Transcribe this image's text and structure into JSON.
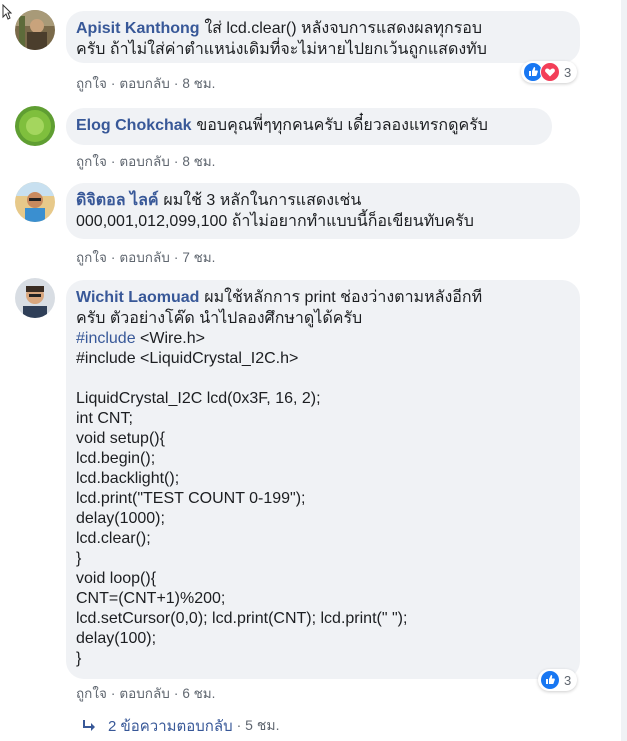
{
  "comments": [
    {
      "author": "Apisit Kanthong",
      "text_line1": "ใส่ lcd.clear() หลังจบการแสดงผลทุกรอบ",
      "text_line2": "ครับ ถ้าไม่ใส่ค่าตำแหน่งเดิมที่จะไม่หายไปยกเว้นถูกแสดงทับ",
      "like_label": "ถูกใจ",
      "reply_label": "ตอบกลับ",
      "time": "8 ชม.",
      "reaction_count": "3",
      "reaction_icons": [
        "like-icon",
        "love-icon"
      ]
    },
    {
      "author": "Elog Chokchak",
      "text_line1": "ขอบคุณพี่ๆทุกคนครับ เดี๋ยวลองแทรกดูครับ",
      "like_label": "ถูกใจ",
      "reply_label": "ตอบกลับ",
      "time": "8 ชม."
    },
    {
      "author": "ดิจิตอล ไลค์",
      "text_line1": "ผมใช้ 3 หลักในการแสดงเช่น",
      "text_line2": "000,001,012,099,100 ถ้าไม่อยากทำแบบนี้ก็อเขียนทับครับ",
      "like_label": "ถูกใจ",
      "reply_label": "ตอบกลับ",
      "time": "7 ชม."
    },
    {
      "author": "Wichit Laomuad",
      "text_line1": "ผมใช้หลักการ print ช่องว่างตามหลังอีกที",
      "text_line2": "ครับ ตัวอย่างโค๊ด นำไปลองศึกษาดูได้ครับ",
      "code_hash_1": "#include",
      "code_rest_1": " <Wire.h>",
      "code_lines": [
        "#include <LiquidCrystal_I2C.h>",
        "",
        "LiquidCrystal_I2C lcd(0x3F, 16, 2);",
        "int CNT;",
        "void setup(){",
        "lcd.begin();",
        "lcd.backlight();",
        "lcd.print(\"TEST COUNT 0-199\");",
        "delay(1000);",
        "lcd.clear();",
        "}",
        "void loop(){",
        "CNT=(CNT+1)%200;",
        "lcd.setCursor(0,0); lcd.print(CNT); lcd.print(\" \");",
        "delay(100);",
        "}"
      ],
      "like_label": "ถูกใจ",
      "reply_label": "ตอบกลับ",
      "time": "6 ชม.",
      "reaction_count": "3",
      "reaction_icons": [
        "like-icon"
      ]
    }
  ],
  "replies_link": {
    "label": "2 ข้อความตอบกลับ",
    "time": "5 ชม."
  },
  "colors": {
    "author": "#385898",
    "bubble": "#f0f2f5",
    "meta": "#606770",
    "like": "#1877f2",
    "love": "#f33e58"
  }
}
